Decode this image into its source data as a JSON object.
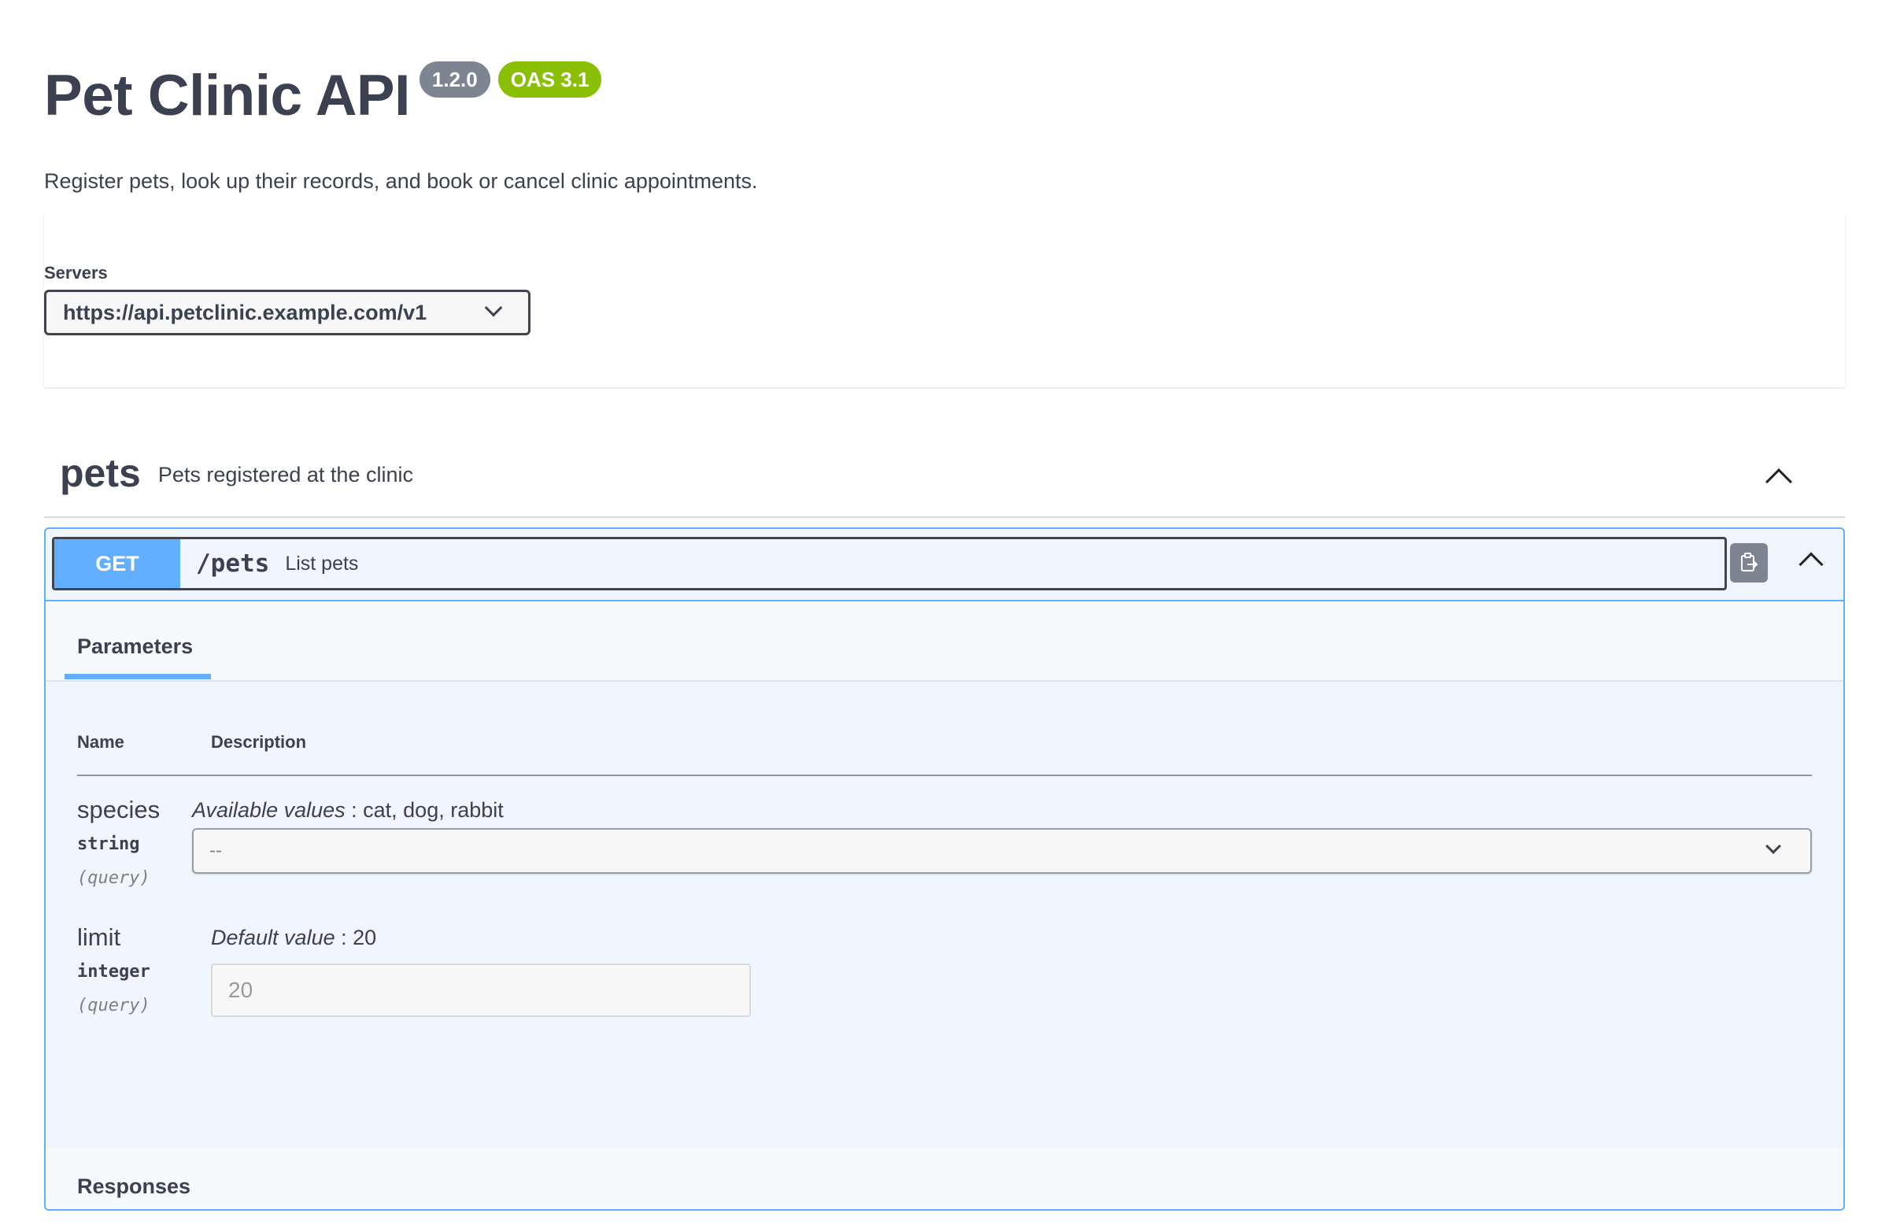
{
  "info": {
    "title": "Pet Clinic API",
    "version": "1.2.0",
    "oas_badge": "OAS 3.1",
    "description": "Register pets, look up their records, and book or cancel clinic appointments."
  },
  "servers": {
    "label": "Servers",
    "selected": "https://api.petclinic.example.com/v1"
  },
  "tag": {
    "name": "pets",
    "description": "Pets registered at the clinic"
  },
  "operation": {
    "method": "GET",
    "path": "/pets",
    "summary": "List pets",
    "tab_label": "Parameters",
    "table_headers": {
      "name": "Name",
      "description": "Description"
    },
    "parameters": [
      {
        "name": "species",
        "type": "string",
        "in": "(query)",
        "desc_label": "Available values",
        "desc_value": " : cat, dog, rabbit",
        "selected": "--"
      },
      {
        "name": "limit",
        "type": "integer",
        "in": "(query)",
        "desc_label": "Default value",
        "desc_value": " : 20",
        "placeholder": "20"
      }
    ],
    "responses_label": "Responses"
  },
  "colors": {
    "get_method": "#61affe",
    "badge_version": "#7d8492",
    "badge_oas": "#89bf04",
    "text": "#3b4151"
  },
  "icons": {
    "copy": "clipboard-copy-icon",
    "expand": "chevron-up-icon",
    "dropdown": "chevron-down-icon"
  }
}
